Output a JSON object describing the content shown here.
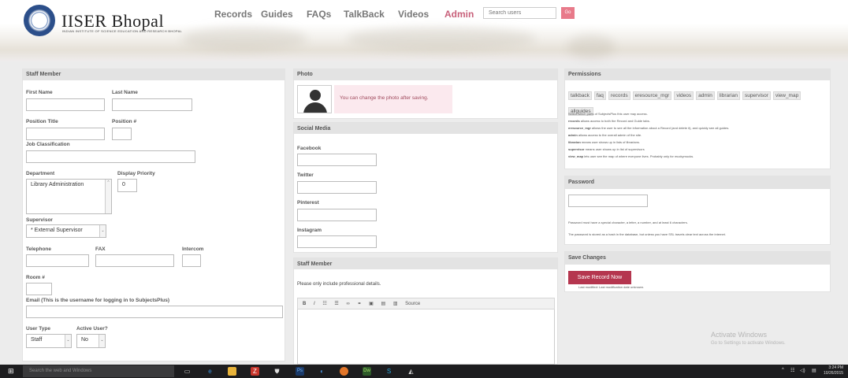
{
  "header": {
    "logo_title": "IISER Bhopal",
    "logo_subtitle": "INDIAN INSTITUTE OF SCIENCE EDUCATION AND RESEARCH BHOPAL",
    "nav": [
      "Records",
      "Guides",
      "FAQs",
      "TalkBack",
      "Videos",
      "Admin"
    ],
    "search_placeholder": "Search users",
    "go_label": "Go"
  },
  "staff": {
    "title": "Staff Member",
    "first_name": "First Name",
    "last_name": "Last Name",
    "position_title": "Position Title",
    "position_num": "Position #",
    "job_classification": "Job Classification",
    "department": "Department",
    "department_value": "Library Administration",
    "display_priority": "Display Priority",
    "display_priority_value": "0",
    "supervisor": "Supervisor",
    "supervisor_value": "* External Supervisor",
    "telephone": "Telephone",
    "fax": "FAX",
    "intercom": "Intercom",
    "room": "Room #",
    "email": "Email (This is the username for logging in to SubjectsPlus)",
    "user_type": "User Type",
    "user_type_value": "Staff",
    "active_user": "Active User?",
    "active_user_value": "No"
  },
  "photo": {
    "title": "Photo",
    "note": "You can change the photo after saving."
  },
  "social": {
    "title": "Social Media",
    "facebook": "Facebook",
    "twitter": "Twitter",
    "pinterest": "Pinterest",
    "instagram": "Instagram"
  },
  "staff_bio": {
    "title": "Staff Member",
    "note": "Please only include professional details.",
    "toolbar": [
      "B",
      "I",
      "☷",
      "☰",
      "∞",
      "⚭",
      "▣",
      "▤",
      "▥",
      "Source"
    ]
  },
  "permissions": {
    "title": "Permissions",
    "tags": [
      "talkback",
      "faq",
      "records",
      "eresource_mgr",
      "videos",
      "admin",
      "librarian",
      "supervisor",
      "view_map",
      "allguides"
    ],
    "intro": "Select which parts of SubjectsPlus this user may access.",
    "lines": [
      {
        "key": "records",
        "text": "allows access to both the Record and Guide tabs."
      },
      {
        "key": "eresource_mgr",
        "text": "allows the user to see all the information about a Record (and delete it), and quickly see all guides."
      },
      {
        "key": "admin",
        "text": "allows access to the overall admin of the site."
      },
      {
        "key": "librarian",
        "text": "means user shows up in lists of librarians."
      },
      {
        "key": "supervisor",
        "text": "means user shows up in list of supervisors"
      },
      {
        "key": "view_map",
        "text": "lets user see the map of where everyone lives. Probably only for muckymucks."
      }
    ]
  },
  "password": {
    "title": "Password",
    "note1": "Password must have a special character, a letter, a number, and at least 6 characters.",
    "note2": "The password is stored as a hash in the database, but unless you have SSL travels clear text across the internet."
  },
  "save": {
    "title": "Save Changes",
    "button": "Save Record Now",
    "modified": "Last modified: Last modification date unknown."
  },
  "watermark": {
    "line1": "Activate Windows",
    "line2": "Go to Settings to activate Windows."
  },
  "taskbar": {
    "search_placeholder": "Search the web and Windows",
    "time": "3:24 PM",
    "date": "10/26/2015"
  }
}
